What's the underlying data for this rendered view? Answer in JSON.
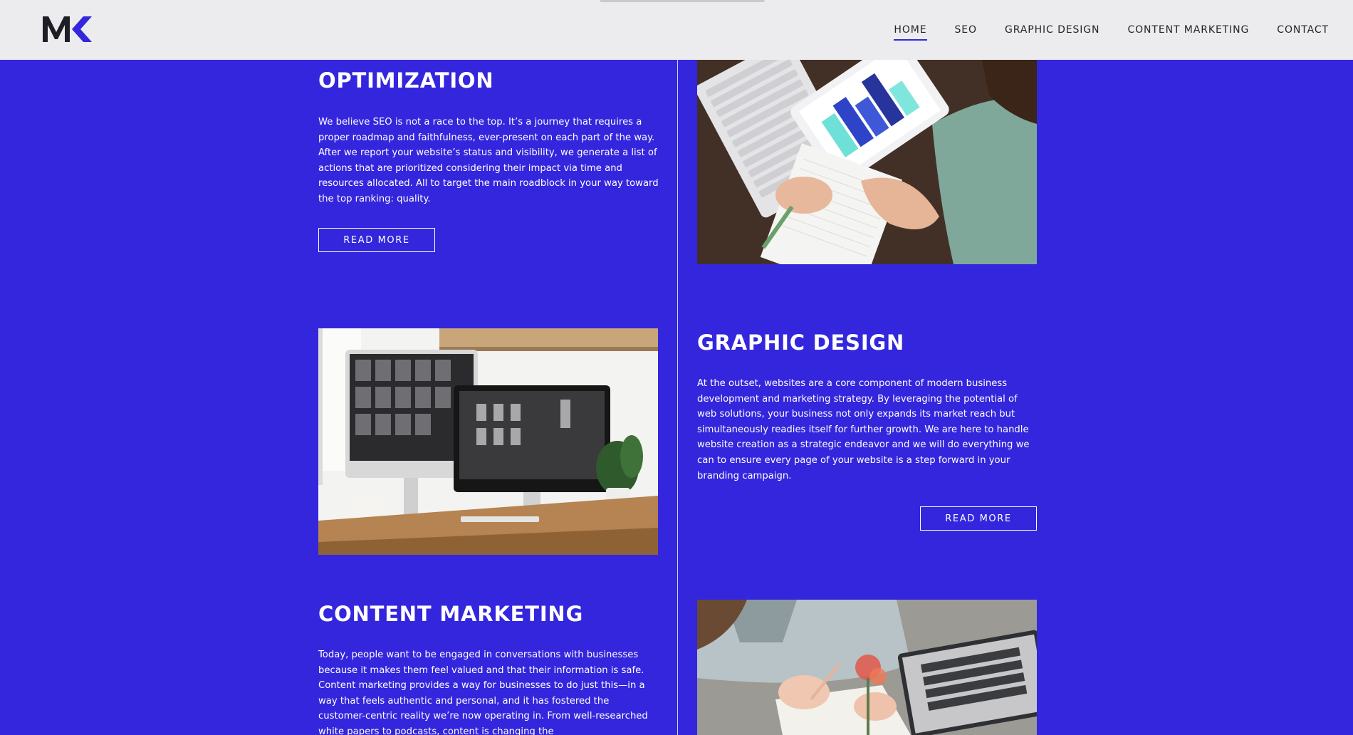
{
  "header": {
    "nav": [
      {
        "label": "HOME",
        "active": true
      },
      {
        "label": "SEO",
        "active": false
      },
      {
        "label": "GRAPHIC DESIGN",
        "active": false
      },
      {
        "label": "CONTENT MARKETING",
        "active": false
      },
      {
        "label": "CONTACT",
        "active": false
      }
    ]
  },
  "sections": {
    "seo": {
      "title": "OPTIMIZATION",
      "body": "We believe SEO is not a race to the top. It’s a journey that requires a proper roadmap and faithfulness, ever-present on each part of the way. After we report your website’s status and visibility, we generate a list of actions that are prioritized considering their impact via time and resources allocated. All to target the main roadblock in your way toward the top ranking: quality.",
      "button": "READ MORE"
    },
    "graphic_design": {
      "title": "GRAPHIC DESIGN",
      "body": "At the outset, websites are a core component of modern business development and marketing strategy. By leveraging the potential of web solutions, your business not only expands its market reach but simultaneously readies itself for further growth. We are here to handle website creation as a strategic endeavor and we will do everything we can to ensure every page of your website is a step forward in your branding campaign.",
      "button": "READ MORE"
    },
    "content_marketing": {
      "title": "CONTENT MARKETING",
      "body": "Today, people want to be engaged in conversations with businesses because it makes them feel valued and that their information is safe. Content marketing provides a way for businesses to do just this—in a way that feels authentic and personal, and it has fostered the customer-centric reality we’re now operating in. From well-researched white papers to podcasts, content is changing the"
    }
  },
  "colors": {
    "background": "#3326dd",
    "header": "#ececee",
    "nav_text": "#23232b",
    "accent": "#3326dd",
    "text": "#ffffff"
  }
}
